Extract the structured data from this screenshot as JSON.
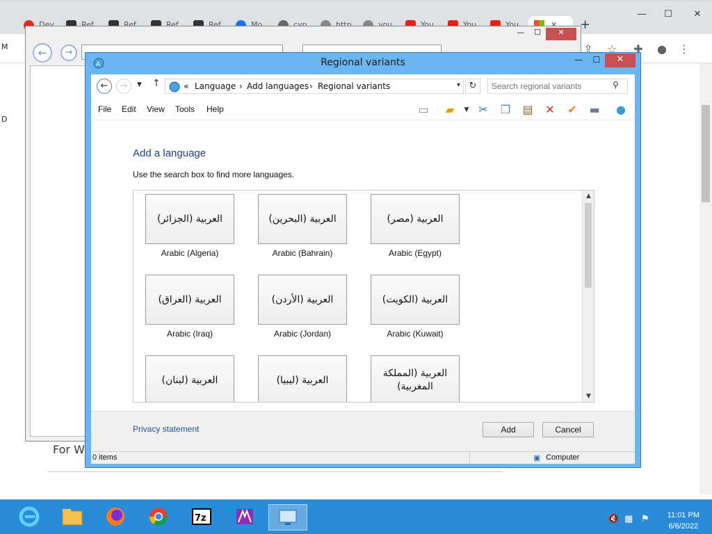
{
  "browser": {
    "tabs": [
      "Dev",
      "Ref",
      "Ref",
      "Ref",
      "Ref",
      "Mo",
      "cvp",
      "http",
      "you",
      "You",
      "You",
      "You"
    ],
    "page_text": "For Wi",
    "left_letters": [
      "M",
      "D"
    ]
  },
  "dialog": {
    "title": "Regional variants",
    "breadcrumbs": [
      "«",
      "Language",
      "Add languages",
      "Regional variants"
    ],
    "search_placeholder": "Search regional variants",
    "menu": [
      "File",
      "Edit",
      "View",
      "Tools",
      "Help"
    ],
    "heading": "Add a language",
    "subtext": "Use the search box to find more languages.",
    "languages": [
      {
        "native": "العربية (الجزائر)",
        "label": "Arabic (Algeria)"
      },
      {
        "native": "العربية (البحرين)",
        "label": "Arabic (Bahrain)"
      },
      {
        "native": "العربية (مصر)",
        "label": "Arabic (Egypt)"
      },
      {
        "native": "العربية (العراق)",
        "label": "Arabic (Iraq)"
      },
      {
        "native": "العربية (الأردن)",
        "label": "Arabic (Jordan)"
      },
      {
        "native": "العربية (الكويت)",
        "label": "Arabic (Kuwait)"
      },
      {
        "native": "العربية (لبنان)",
        "label": ""
      },
      {
        "native": "العربية (ليبيا)",
        "label": ""
      },
      {
        "native": "العربية (المملكة المغربية)",
        "label": ""
      }
    ],
    "privacy": "Privacy statement",
    "add_button": "Add",
    "cancel_button": "Cancel",
    "status_items": "0 items",
    "status_location": "Computer"
  },
  "taskbar": {
    "time": "11:01 PM",
    "date": "6/6/2022"
  },
  "colors": {
    "dialog_frame": "#6bb6f0",
    "heading": "#1e3f7a",
    "link": "#1e4f9a",
    "close": "#c75050",
    "taskbar": "#2a8bd8"
  }
}
